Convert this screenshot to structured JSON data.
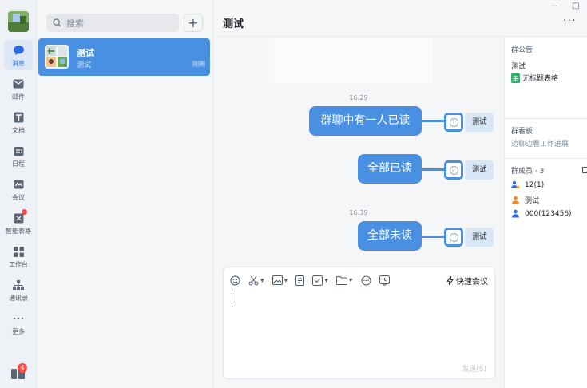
{
  "rail": {
    "items": [
      {
        "label": "消息",
        "icon": "chat-bubble-icon",
        "active": true
      },
      {
        "label": "邮件",
        "icon": "mail-icon"
      },
      {
        "label": "文档",
        "icon": "document-icon"
      },
      {
        "label": "日程",
        "icon": "calendar-icon"
      },
      {
        "label": "会议",
        "icon": "meeting-icon"
      },
      {
        "label": "智能表格",
        "icon": "smart-sheet-icon"
      },
      {
        "label": "工作台",
        "icon": "workbench-icon"
      },
      {
        "label": "通讯录",
        "icon": "contacts-icon"
      },
      {
        "label": "更多",
        "icon": "more-dots-icon"
      }
    ],
    "bottom_badge": "4"
  },
  "list": {
    "search_placeholder": "搜索",
    "add_label": "+",
    "conversation": {
      "name": "测试",
      "last_msg": "测试",
      "time": "刚刚"
    }
  },
  "chat": {
    "title": "测试",
    "more": "···",
    "win_min": "—",
    "win_max": "□",
    "messages": [
      {
        "time": "16:29",
        "text": "群聊中有一人已读",
        "status": "!",
        "sender": "测试"
      },
      {
        "time": "",
        "text": "全部已读",
        "status": "✓",
        "sender": "测试"
      },
      {
        "time": "16:39",
        "text": "全部未读",
        "status": "",
        "sender": "测试"
      }
    ],
    "composer": {
      "quick_meet": "快速会议",
      "send": "发送(S)"
    }
  },
  "info": {
    "notice_title": "群公告",
    "notice_text": "测试",
    "notice_file": "无标题表格",
    "board_title": "群看板",
    "board_sub": "边聊边看工作进展",
    "members_title": "群成员 · 3",
    "members": [
      "12(1)",
      "测试",
      "000(123456)"
    ]
  },
  "colors": {
    "accent": "#4a90e2",
    "badge": "#f54a45"
  }
}
